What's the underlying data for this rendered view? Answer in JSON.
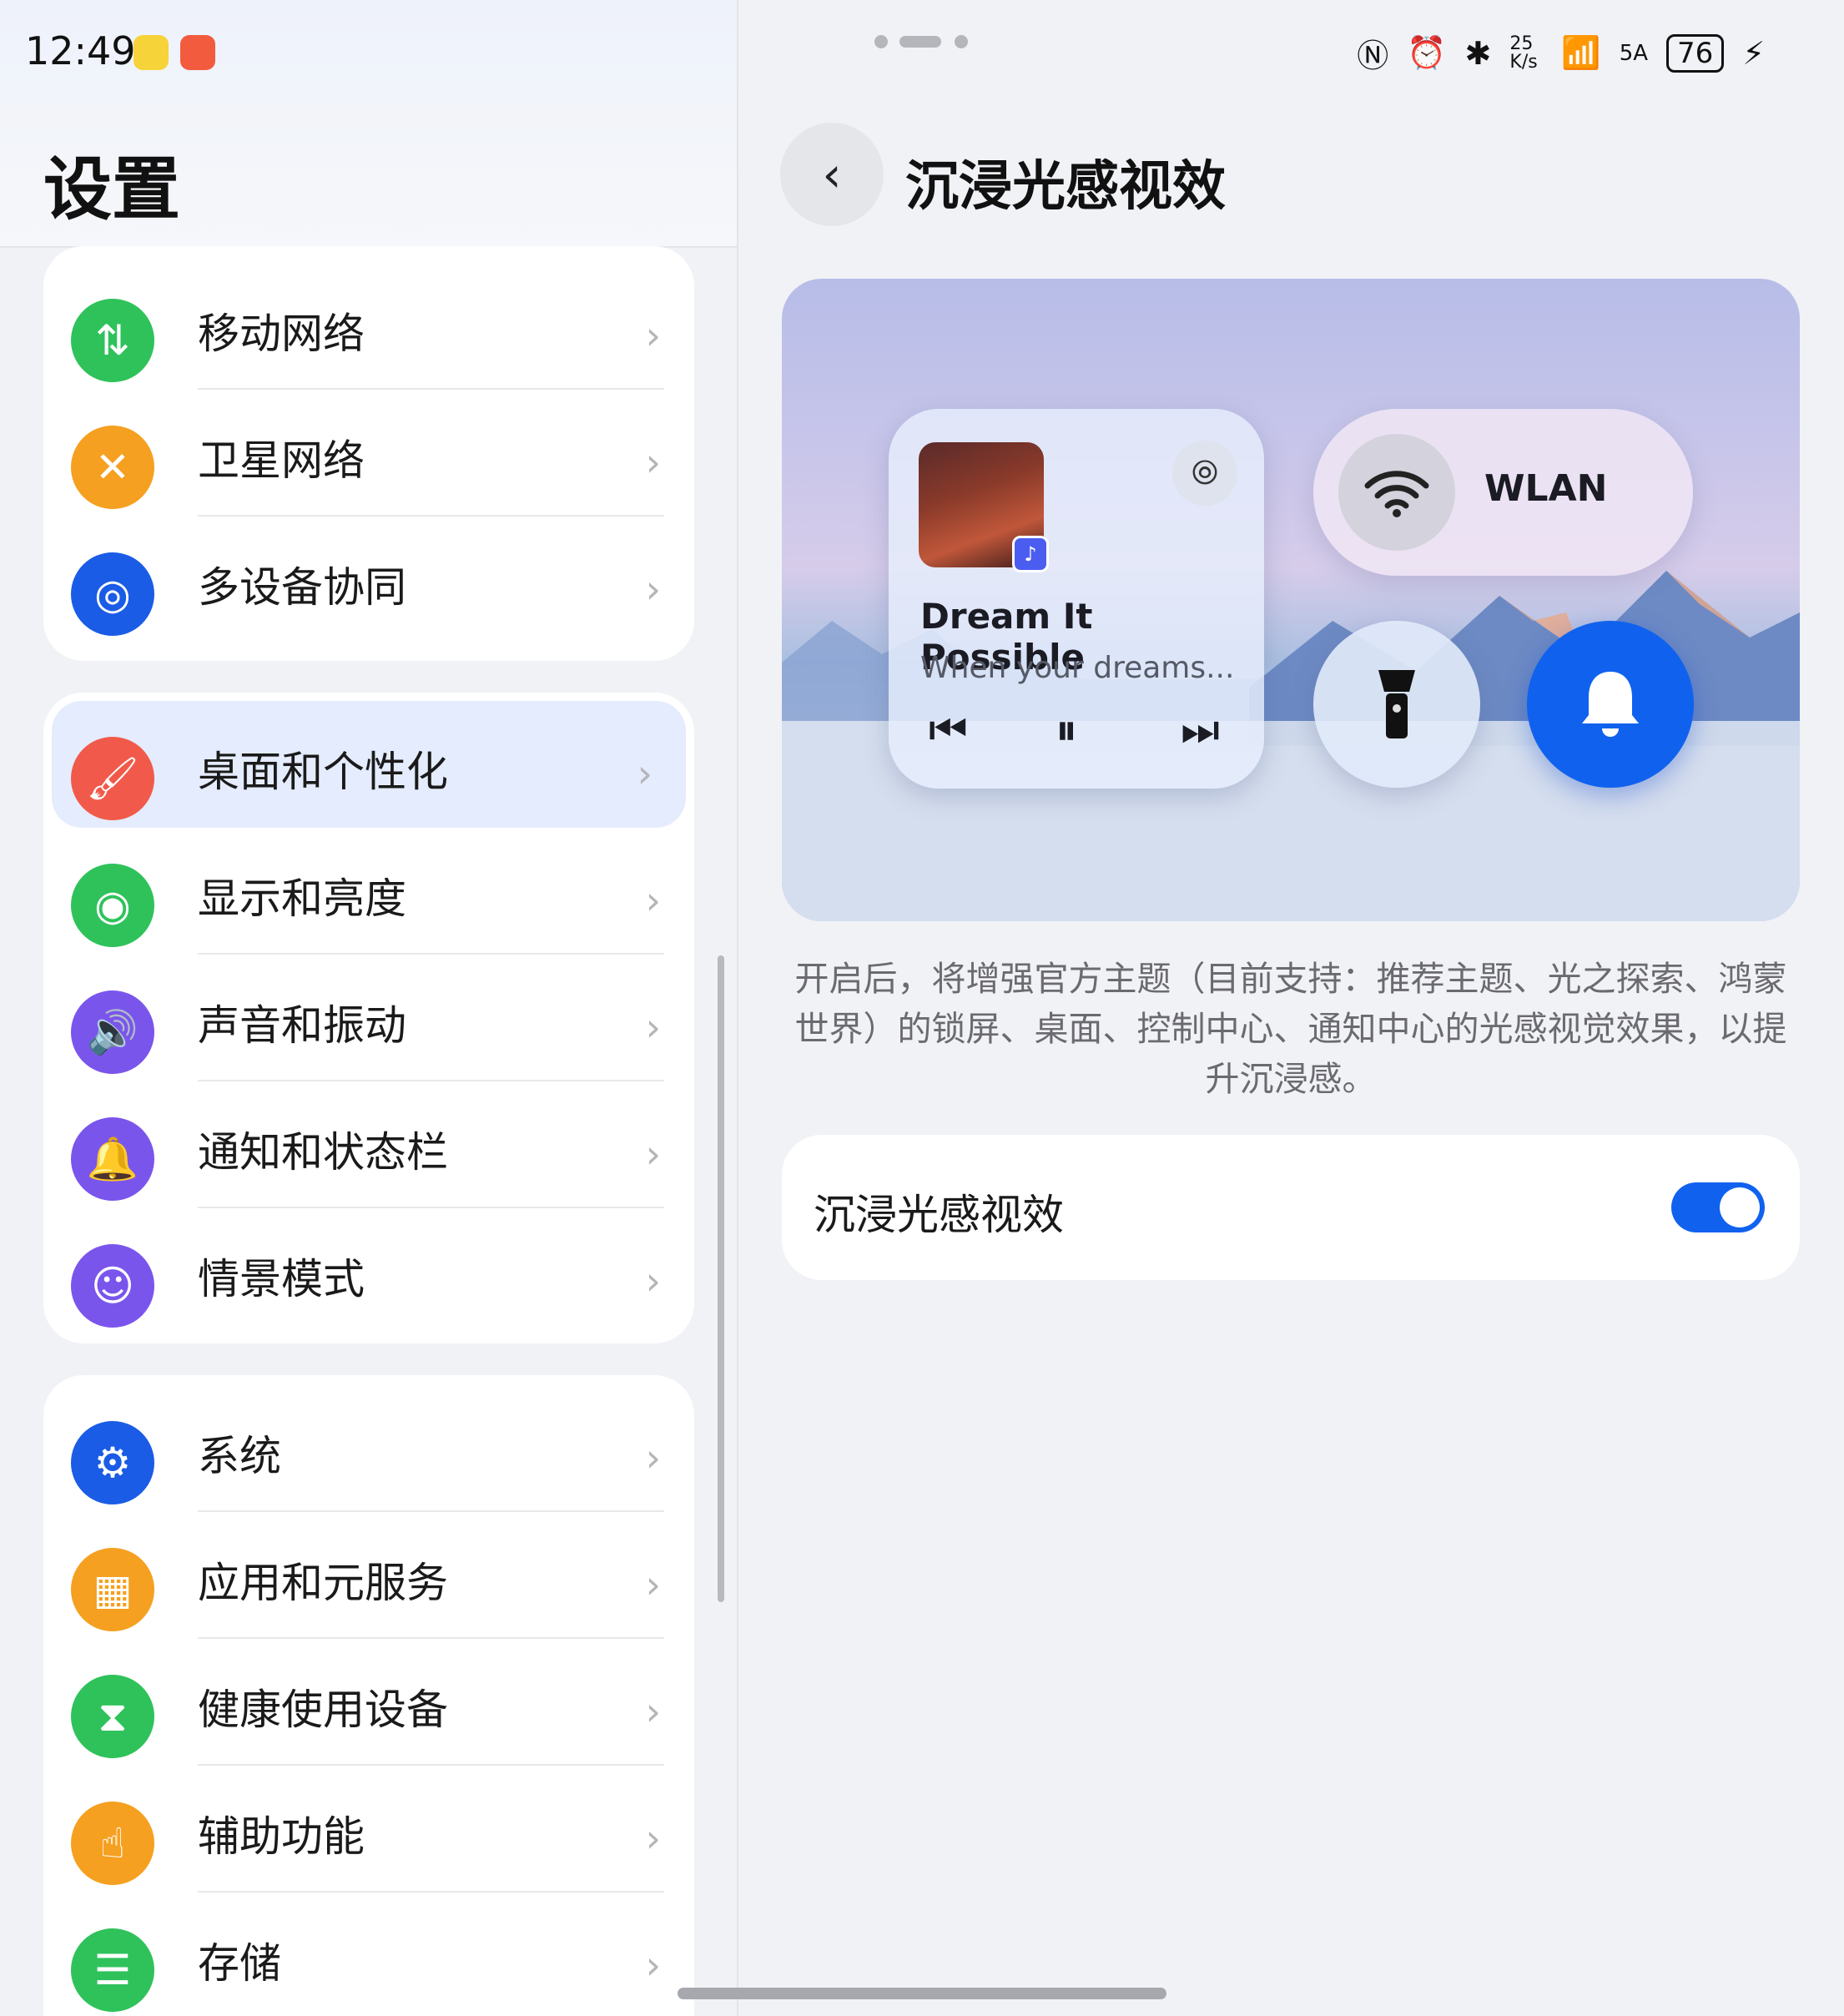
{
  "status_bar": {
    "time": "12:49",
    "net_speed": "25 K/s",
    "signal": "5A",
    "battery": "76"
  },
  "left_panel": {
    "title": "设置",
    "groups": [
      {
        "items": [
          {
            "label": "移动网络",
            "icon": "mobile-data-icon",
            "color": "#2fc25b"
          },
          {
            "label": "卫星网络",
            "icon": "satellite-icon",
            "color": "#f5a020"
          },
          {
            "label": "多设备协同",
            "icon": "multi-device-icon",
            "color": "#1a5ce6"
          }
        ]
      },
      {
        "items": [
          {
            "label": "桌面和个性化",
            "icon": "brush-icon",
            "color": "#f15a4a",
            "selected": true
          },
          {
            "label": "显示和亮度",
            "icon": "eye-icon",
            "color": "#2fc25b"
          },
          {
            "label": "声音和振动",
            "icon": "speaker-icon",
            "color": "#7a55ec"
          },
          {
            "label": "通知和状态栏",
            "icon": "bell-icon",
            "color": "#7a55ec"
          },
          {
            "label": "情景模式",
            "icon": "profile-icon",
            "color": "#7a55ec"
          }
        ]
      },
      {
        "items": [
          {
            "label": "系统",
            "icon": "gear-icon",
            "color": "#1a5ce6"
          },
          {
            "label": "应用和元服务",
            "icon": "apps-icon",
            "color": "#f5a020"
          },
          {
            "label": "健康使用设备",
            "icon": "hourglass-icon",
            "color": "#2fc25b"
          },
          {
            "label": "辅助功能",
            "icon": "hand-icon",
            "color": "#f5a020"
          },
          {
            "label": "存储",
            "icon": "storage-icon",
            "color": "#2fc25b"
          }
        ]
      }
    ]
  },
  "right_panel": {
    "title": "沉浸光感视效",
    "preview": {
      "song_title": "Dream It Possible",
      "song_subtitle": "When your dreams...",
      "wlan_label": "WLAN"
    },
    "description": "开启后，将增强官方主题（目前支持：推荐主题、光之探索、鸿蒙世界）的锁屏、桌面、控制中心、通知中心的光感视觉效果，以提升沉浸感。",
    "toggle": {
      "label": "沉浸光感视效",
      "on": true
    }
  }
}
